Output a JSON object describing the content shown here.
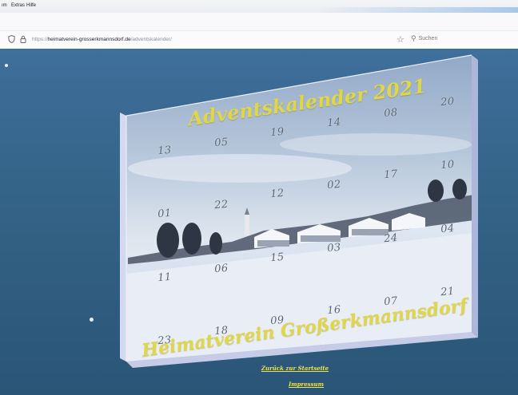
{
  "menubar": {
    "items": [
      "ım",
      "Extras",
      "Hilfe"
    ]
  },
  "addressbar": {
    "url_prefix": "https://",
    "url_host": "heimatverein-grosserkmannsdorf.de",
    "url_path": "/adventskalender/",
    "search_placeholder": "Suchen"
  },
  "icons": {
    "shield": "shield-icon",
    "lock": "lock-icon",
    "star": "bookmark-star-icon",
    "search": "search-icon"
  },
  "calendar": {
    "title": "Adventskalender 2021",
    "footer": "Heimatverein Großerkmannsdorf",
    "doors": [
      "13",
      "05",
      "19",
      "14",
      "08",
      "20",
      "10",
      "17",
      "02",
      "12",
      "22",
      "01",
      "04",
      "24",
      "03",
      "15",
      "06",
      "11",
      "21",
      "07",
      "16",
      "09",
      "18",
      "23"
    ],
    "title_color": "#e0d64a"
  },
  "links": {
    "back": "Zurück zur Startseite",
    "imprint": "Impressum"
  }
}
